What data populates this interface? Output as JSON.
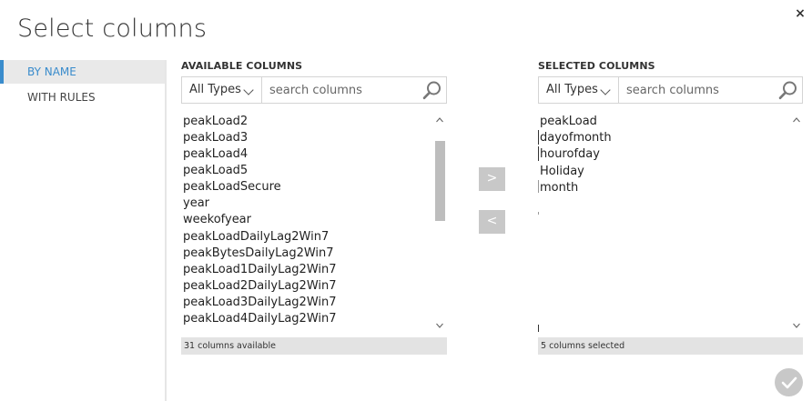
{
  "dialog": {
    "title": "Select columns",
    "close_label": "×"
  },
  "sidebar": {
    "items": [
      {
        "label": "BY NAME"
      },
      {
        "label": "WITH RULES"
      }
    ]
  },
  "available": {
    "heading": "AVAILABLE COLUMNS",
    "type_filter": "All Types",
    "search_placeholder": "search columns",
    "items": [
      "peakLoad2",
      "peakLoad3",
      "peakLoad4",
      "peakLoad5",
      "peakLoadSecure",
      "year",
      "weekofyear",
      "peakLoadDailyLag2Win7",
      "peakBytesDailyLag2Win7",
      "peakLoad1DailyLag2Win7",
      "peakLoad2DailyLag2Win7",
      "peakLoad3DailyLag2Win7",
      "peakLoad4DailyLag2Win7"
    ],
    "count_text": "31 columns available"
  },
  "selected": {
    "heading": "SELECTED COLUMNS",
    "type_filter": "All Types",
    "search_placeholder": "search columns",
    "items": [
      "peakLoad",
      "dayofmonth",
      "hourofday",
      "Holiday",
      "month"
    ],
    "count_text": "5 columns selected"
  },
  "actions": {
    "add_label": ">",
    "remove_label": "<"
  },
  "icons": {
    "search": "search-icon",
    "ok": "checkmark-icon",
    "close": "close-icon"
  },
  "colors": {
    "accent": "#3a8ccc",
    "button_gray": "#c8c8c8"
  }
}
